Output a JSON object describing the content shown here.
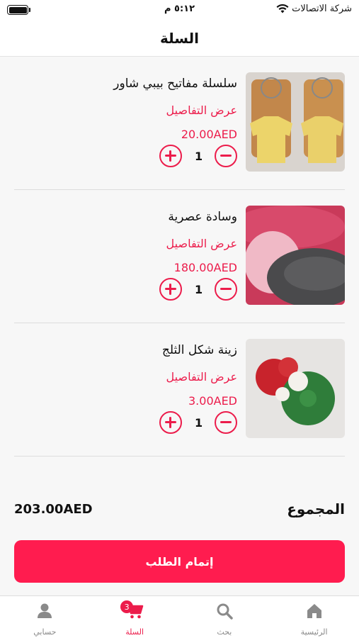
{
  "status_bar": {
    "carrier": "شركة الاتصالات",
    "time": "٥:١٢ م"
  },
  "header": {
    "title": "السلة"
  },
  "cart_items": [
    {
      "name": "سلسلة مفاتيح بيبي شاور",
      "details": "عرض التفاصيل",
      "price": "20.00AED",
      "quantity": "1"
    },
    {
      "name": "وسادة عصرية",
      "details": "عرض التفاصيل",
      "price": "180.00AED",
      "quantity": "1"
    },
    {
      "name": "زينة شكل الثلج",
      "details": "عرض التفاصيل",
      "price": "3.00AED",
      "quantity": "1"
    }
  ],
  "summary": {
    "total_label": "المجموع",
    "total_amount": "203.00AED"
  },
  "checkout_label": "إتمام الطلب",
  "tabbar": {
    "home": "الرئيسية",
    "search": "بحث",
    "cart": "السلة",
    "cart_badge": "3",
    "account": "حسابي"
  },
  "colors": {
    "accent": "#ec1c4b",
    "button": "#ff1c4f"
  }
}
